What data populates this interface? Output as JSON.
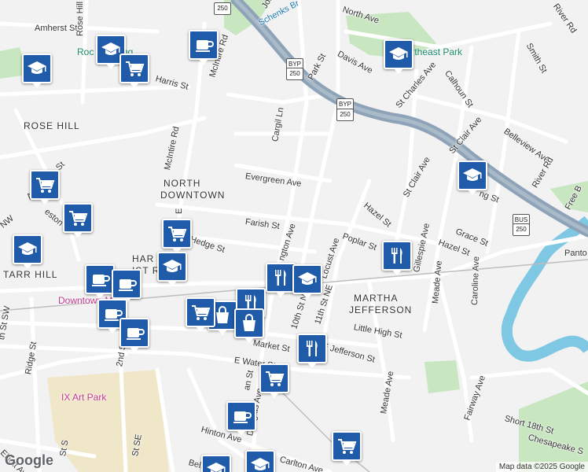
{
  "map": {
    "colors": {
      "land": "#f2f2f2",
      "road": "#ffffff",
      "highway": "#8fa3b8",
      "water": "#7ec8e3",
      "park": "#c8e6c0",
      "sand": "#f0e6c8",
      "marker": "#1f5ba8"
    },
    "streets": [
      {
        "id": "amherst-st",
        "label": "Amherst St"
      },
      {
        "id": "rose-hill-dr",
        "label": "Rose Hill Dr"
      },
      {
        "id": "harris-st",
        "label": "Harris St"
      },
      {
        "id": "mcintire-rd",
        "label": "McIntire Rd"
      },
      {
        "id": "mcintire-rd-2",
        "label": "McIntire Rd"
      },
      {
        "id": "park-st",
        "label": "Park St"
      },
      {
        "id": "davis-ave",
        "label": "Davis Ave"
      },
      {
        "id": "north-ave",
        "label": "North Ave"
      },
      {
        "id": "river-rd-top",
        "label": "River Rd"
      },
      {
        "id": "smith-st",
        "label": "Smith St"
      },
      {
        "id": "calhoun-st",
        "label": "Calhoun St"
      },
      {
        "id": "st-charles-ave",
        "label": "St Charles Ave"
      },
      {
        "id": "belleview-ave",
        "label": "Belleview Ave"
      },
      {
        "id": "st-clair-ave",
        "label": "St Clair Ave"
      },
      {
        "id": "st-clair-ave-2",
        "label": "St Clair Ave"
      },
      {
        "id": "cargil-ln",
        "label": "Cargil Ln"
      },
      {
        "id": "evergreen-ave",
        "label": "Evergreen Ave"
      },
      {
        "id": "albemarle-st",
        "label": "Albemarle St"
      },
      {
        "id": "preston",
        "label": "eston"
      },
      {
        "id": "farish-st",
        "label": "Farish St"
      },
      {
        "id": "hedge-st",
        "label": "Hedge St"
      },
      {
        "id": "hazel-st",
        "label": "Hazel St"
      },
      {
        "id": "hazel-st-2",
        "label": "Hazel St"
      },
      {
        "id": "poplar-st",
        "label": "Poplar St"
      },
      {
        "id": "locust-ave",
        "label": "Locust Ave"
      },
      {
        "id": "lexington-ave",
        "label": "ngton Ave"
      },
      {
        "id": "gillespie-ave",
        "label": "Gillespie Ave"
      },
      {
        "id": "grace-st",
        "label": "Grace St"
      },
      {
        "id": "river-rd",
        "label": "River Rd"
      },
      {
        "id": "free-bridge",
        "label": "Free B"
      },
      {
        "id": "pantops",
        "label": "Panto"
      },
      {
        "id": "high-st",
        "label": "ng St"
      },
      {
        "id": "10th-st-ne",
        "label": "10th St NE"
      },
      {
        "id": "11th-st-ne",
        "label": "11th St NE"
      },
      {
        "id": "little-high-st",
        "label": "Little High St"
      },
      {
        "id": "meade-ave",
        "label": "Meade Ave"
      },
      {
        "id": "meade-ave-2",
        "label": "Meade Ave"
      },
      {
        "id": "caroline-ave",
        "label": "Caroline Ave"
      },
      {
        "id": "market-st",
        "label": "Market St"
      },
      {
        "id": "e-jefferson-st",
        "label": "E Jefferson St"
      },
      {
        "id": "e-water-st",
        "label": "E Water St"
      },
      {
        "id": "2nd-st",
        "label": "2nd St"
      },
      {
        "id": "ridge-st",
        "label": "Ridge St"
      },
      {
        "id": "sw-st",
        "label": "th St SW"
      },
      {
        "id": "nw",
        "label": "NW"
      },
      {
        "id": "douglas-ave",
        "label": "Douglas Ave"
      },
      {
        "id": "an-st",
        "label": "an St"
      },
      {
        "id": "hinton-ave",
        "label": "Hinton Ave"
      },
      {
        "id": "elliott-ave",
        "label": "Elliott Ave"
      },
      {
        "id": "st-s",
        "label": "St S"
      },
      {
        "id": "st-se",
        "label": "St SE"
      },
      {
        "id": "belmont",
        "label": "Belm"
      },
      {
        "id": "carlton-ave",
        "label": "Carlton Ave"
      },
      {
        "id": "fairway-ave",
        "label": "Fairway Ave"
      },
      {
        "id": "short-18th-st",
        "label": "Short 18th St"
      },
      {
        "id": "chesapeake-st",
        "label": "Chesapeake S"
      },
      {
        "id": "schenks-br",
        "label": "Schenks Br"
      },
      {
        "id": "john",
        "label": "John"
      },
      {
        "id": "e-ne",
        "label": "E"
      }
    ],
    "districts": [
      {
        "id": "rose-hill",
        "label": "ROSE HILL"
      },
      {
        "id": "north-downtown-1",
        "label": "NORTH"
      },
      {
        "id": "north-downtown-2",
        "label": "DOWNTOWN"
      },
      {
        "id": "martha-jefferson-1",
        "label": "MARTHA"
      },
      {
        "id": "martha-jefferson-2",
        "label": "JEFFERSON"
      },
      {
        "id": "starr-hill",
        "label": "TARR HILL"
      },
      {
        "id": "historic-1",
        "label": "HAR      VILLE"
      },
      {
        "id": "historic-2",
        "label": "IST       RICT"
      }
    ],
    "pois": [
      {
        "id": "rock-climbing",
        "label": "Roc          Climbing"
      },
      {
        "id": "northeast-park",
        "label": "Northeast Park"
      },
      {
        "id": "downtown-mall",
        "label": "Downtown M"
      },
      {
        "id": "ix-art-park",
        "label": "IX Art Park"
      }
    ],
    "shields": [
      {
        "id": "us250-top",
        "label": "250"
      },
      {
        "id": "byp-1",
        "label": "BYP"
      },
      {
        "id": "us250-1",
        "label": "250"
      },
      {
        "id": "byp-2",
        "label": "BYP"
      },
      {
        "id": "us250-2",
        "label": "250"
      },
      {
        "id": "bus-250",
        "label": "BUS"
      },
      {
        "id": "us250-3",
        "label": "250"
      }
    ],
    "markers": [
      {
        "icon": "school"
      },
      {
        "icon": "school"
      },
      {
        "icon": "coffee"
      },
      {
        "icon": "shopping-cart"
      },
      {
        "icon": "shopping-cart"
      },
      {
        "icon": "school"
      },
      {
        "icon": "shopping-cart"
      },
      {
        "icon": "shopping-cart"
      },
      {
        "icon": "school"
      },
      {
        "icon": "school"
      },
      {
        "icon": "coffee"
      },
      {
        "icon": "coffee"
      },
      {
        "icon": "restaurant"
      },
      {
        "icon": "school"
      },
      {
        "icon": "restaurant"
      },
      {
        "icon": "restaurant"
      },
      {
        "icon": "shopping-bag"
      },
      {
        "icon": "shopping-bag"
      },
      {
        "icon": "shopping-cart"
      },
      {
        "icon": "coffee"
      },
      {
        "icon": "coffee"
      },
      {
        "icon": "restaurant"
      },
      {
        "icon": "shopping-cart"
      },
      {
        "icon": "coffee"
      },
      {
        "icon": "shopping-cart"
      },
      {
        "icon": "school"
      },
      {
        "icon": "school"
      },
      {
        "icon": "school"
      }
    ],
    "attribution": {
      "brand": "Google",
      "copyright": "Map data ©2025 Google"
    }
  }
}
